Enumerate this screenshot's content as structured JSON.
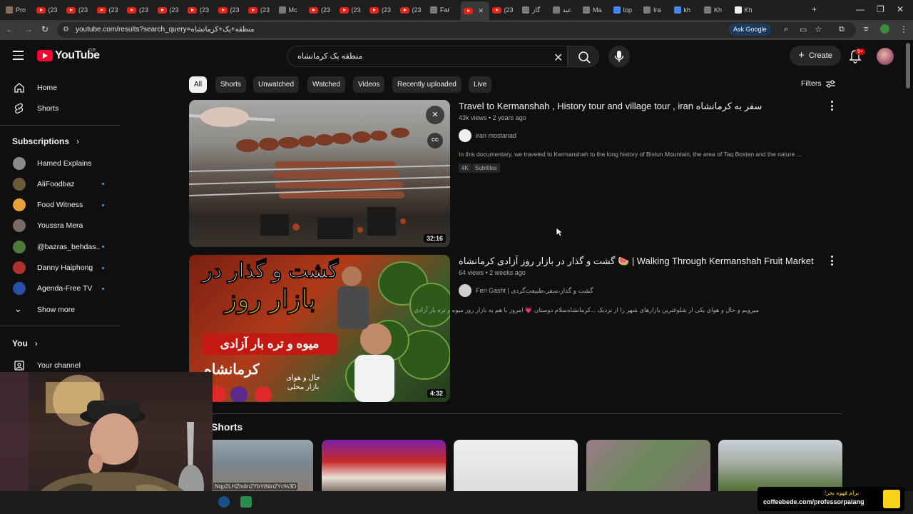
{
  "browser": {
    "tabs": [
      {
        "label": "Pro",
        "icon": "avatar-icon"
      },
      {
        "label": "(23",
        "icon": "youtube-icon"
      },
      {
        "label": "(23",
        "icon": "youtube-icon"
      },
      {
        "label": "(23",
        "icon": "youtube-icon"
      },
      {
        "label": "(23",
        "icon": "youtube-icon"
      },
      {
        "label": "(23",
        "icon": "youtube-icon"
      },
      {
        "label": "(23",
        "icon": "youtube-icon"
      },
      {
        "label": "(23",
        "icon": "youtube-icon"
      },
      {
        "label": "(23",
        "icon": "youtube-icon"
      },
      {
        "label": "Mc",
        "icon": "site-icon"
      },
      {
        "label": "(23",
        "icon": "youtube-icon"
      },
      {
        "label": "(23",
        "icon": "youtube-icon"
      },
      {
        "label": "(23",
        "icon": "youtube-icon"
      },
      {
        "label": "(23",
        "icon": "youtube-icon"
      },
      {
        "label": "Far",
        "icon": "site-icon"
      },
      {
        "label": "",
        "icon": "youtube-icon",
        "active": true
      },
      {
        "label": "(23",
        "icon": "youtube-icon"
      },
      {
        "label": "گاز",
        "icon": "site-icon"
      },
      {
        "label": "عید",
        "icon": "site-icon"
      },
      {
        "label": "Ma",
        "icon": "site-icon"
      },
      {
        "label": "top",
        "icon": "google-icon"
      },
      {
        "label": "Ira",
        "icon": "site-icon"
      },
      {
        "label": "kh",
        "icon": "google-icon"
      },
      {
        "label": "Kh",
        "icon": "site-icon"
      },
      {
        "label": "Kh",
        "icon": "wikipedia-icon"
      }
    ],
    "url": "youtube.com/results?search_query=منطقه+یک+کرمانشاه",
    "ask_google": "Ask Google"
  },
  "youtube": {
    "logo": "YouTube",
    "region": "GB",
    "search_value": "منطقه یک کرمانشاه",
    "create_label": "Create",
    "notif_count": "9+"
  },
  "sidebar": {
    "home": "Home",
    "shorts": "Shorts",
    "subscriptions": "Subscriptions",
    "channels": [
      {
        "name": "Hamed Explains",
        "dot": false,
        "color": "#8a8a8a"
      },
      {
        "name": "AliFoodbaz",
        "dot": true,
        "color": "#6b5a3a"
      },
      {
        "name": "Food Witness",
        "dot": true,
        "color": "#e8a23a"
      },
      {
        "name": "Youssra Mera",
        "dot": false,
        "color": "#7a6a66"
      },
      {
        "name": "@bazras_behdas...",
        "dot": true,
        "color": "#4d7a3a"
      },
      {
        "name": "Danny Haiphong",
        "dot": true,
        "color": "#b0302a"
      },
      {
        "name": "Agenda-Free TV",
        "dot": true,
        "color": "#2a4fa8"
      }
    ],
    "show_more": "Show more",
    "you": "You",
    "your_channel": "Your channel"
  },
  "filters": {
    "chips": [
      "All",
      "Shorts",
      "Unwatched",
      "Watched",
      "Videos",
      "Recently uploaded",
      "Live"
    ],
    "selected": "All",
    "filters_label": "Filters"
  },
  "results": [
    {
      "title": "Travel to Kermanshah , History tour and village tour , iran سفر به کرمانشاه",
      "views": "43k views",
      "age": "2 years ago",
      "channel": "iran mostanad",
      "description": "In this documentary, we traveled to Kermanshah to the long history of Bistun Mountain, the area of Taq Bostan and the nature ...",
      "badges": [
        "4K",
        "Subtitles"
      ],
      "duration": "32:16"
    },
    {
      "title": "گشت و گذار در بازار روز آزادی کرمانشاه 🍉 | Walking Through Kermanshah Fruit Market",
      "views": "64 views",
      "age": "2 weeks ago",
      "channel": "Feri Gasht | گشت و گذار،سفر،طبیعت‌گردی",
      "description": "میرویم و حال و هوای یکی از شلوغترین بازارهای شهر را از نزدیک ...کرمانشاه‌سلام دوستان 💗 امروز با هم به بازار روز میوه و تره بار آزادی",
      "duration": "4:32",
      "thumb_text": {
        "line1": "گشت و گذار در",
        "line2": "بازار روز",
        "line3": "میوه و تره بار آزادی",
        "line4": "کرمانشاه",
        "line5": "حال و هوای بازار محلی"
      }
    }
  ],
  "shorts": {
    "heading": "Shorts",
    "overlay_text": "Nqp2LHZhdin2YbYtNin2Yc%3D"
  },
  "overlay": {
    "coffee_line1": "برام قهوه بخر!",
    "coffee_line2": "coffeebede.com/professorpalang"
  }
}
